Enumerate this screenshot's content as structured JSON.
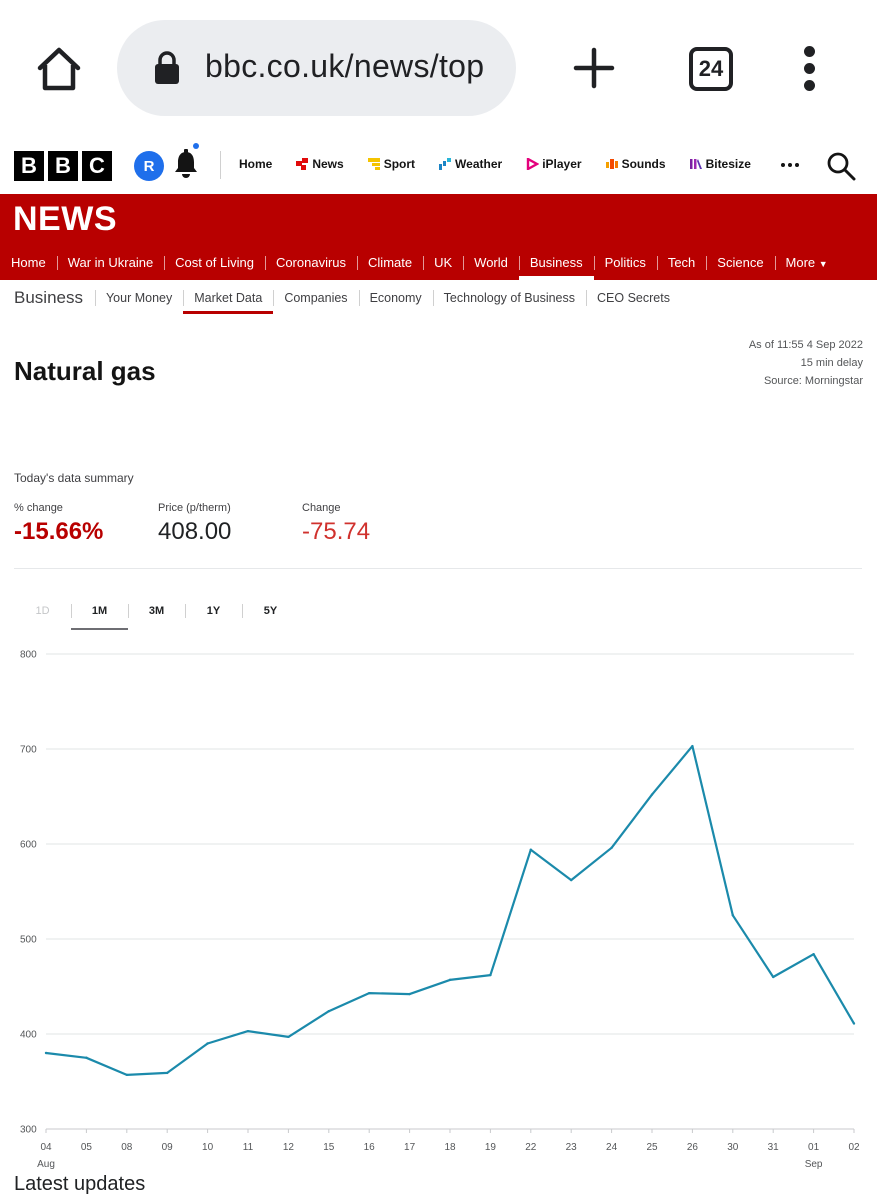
{
  "browser": {
    "url": "bbc.co.uk/news/top",
    "tab_count": "24"
  },
  "bbc_header": {
    "logo_letters": [
      "B",
      "B",
      "C"
    ],
    "avatar_initial": "R",
    "nav": [
      {
        "label": "Home",
        "icon": "none",
        "color": ""
      },
      {
        "label": "News",
        "icon": "news-icon",
        "color": "#e10a0a"
      },
      {
        "label": "Sport",
        "icon": "sport-icon",
        "color": "#f5c400"
      },
      {
        "label": "Weather",
        "icon": "weather-icon",
        "color": "#1b84c5"
      },
      {
        "label": "iPlayer",
        "icon": "iplayer-icon",
        "color": "#e4017c"
      },
      {
        "label": "Sounds",
        "icon": "sounds-icon",
        "color": "#f54a00"
      },
      {
        "label": "Bitesize",
        "icon": "bitesize-icon",
        "color": "#7b1fa2"
      }
    ]
  },
  "news_bar": {
    "logo": "NEWS",
    "nav": [
      "Home",
      "War in Ukraine",
      "Cost of Living",
      "Coronavirus",
      "Climate",
      "UK",
      "World",
      "Business",
      "Politics",
      "Tech",
      "Science",
      "More"
    ],
    "active": "Business"
  },
  "business_nav": {
    "section": "Business",
    "items": [
      "Your Money",
      "Market Data",
      "Companies",
      "Economy",
      "Technology of Business",
      "CEO Secrets"
    ],
    "active": "Market Data"
  },
  "page": {
    "title": "Natural gas",
    "as_of": "As of 11:55 4 Sep 2022",
    "delay": "15 min delay",
    "source": "Source: Morningstar",
    "summary_label": "Today's data summary",
    "stats": [
      {
        "label": "% change",
        "value": "-15.66%"
      },
      {
        "label": "Price (p/therm)",
        "value": "408.00"
      },
      {
        "label": "Change",
        "value": "-75.74"
      }
    ],
    "ranges": [
      {
        "label": "1D",
        "state": "disabled"
      },
      {
        "label": "1M",
        "state": "active"
      },
      {
        "label": "3M",
        "state": "normal"
      },
      {
        "label": "1Y",
        "state": "normal"
      },
      {
        "label": "5Y",
        "state": "normal"
      }
    ],
    "latest_updates": "Latest updates"
  },
  "chart_data": {
    "type": "line",
    "title": "",
    "xlabel": "",
    "ylabel": "",
    "ylim": [
      300,
      800
    ],
    "yticks": [
      300,
      400,
      500,
      600,
      700,
      800
    ],
    "grid": true,
    "line_color": "#1b8aab",
    "x": [
      "04",
      "05",
      "08",
      "09",
      "10",
      "11",
      "12",
      "15",
      "16",
      "17",
      "18",
      "19",
      "22",
      "23",
      "24",
      "25",
      "26",
      "30",
      "31",
      "01",
      "02"
    ],
    "month_labels": [
      {
        "index": 0,
        "label": "Aug"
      },
      {
        "index": 19,
        "label": "Sep"
      }
    ],
    "series": [
      {
        "values": [
          380,
          375,
          357,
          359,
          390,
          403,
          397,
          424,
          443,
          442,
          457,
          462,
          594,
          562,
          596,
          652,
          703,
          525,
          460,
          484,
          411
        ]
      }
    ]
  }
}
